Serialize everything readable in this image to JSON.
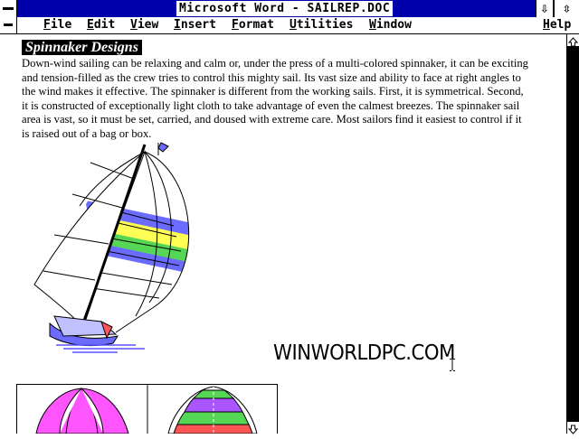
{
  "window": {
    "title": "Microsoft Word - SAILREP.DOC",
    "minimize_glyph": "⇩",
    "maximize_glyph": "⇳"
  },
  "menu": {
    "items": [
      {
        "label": "File"
      },
      {
        "label": "Edit"
      },
      {
        "label": "View"
      },
      {
        "label": "Insert"
      },
      {
        "label": "Format"
      },
      {
        "label": "Utilities"
      },
      {
        "label": "Window"
      }
    ],
    "help": "Help"
  },
  "document": {
    "heading": "Spinnaker Designs",
    "paragraph": "Down-wind sailing can be relaxing and calm or, under the press of a multi-colored spinnaker, it can be exciting and tension-filled as the crew tries to control this mighty sail.  Its vast size and ability to face at right angles to the wind makes it effective. The spinnaker is different from the working sails.  First, it is symmetrical.  Second, it is constructed of exceptionally light cloth to take advantage of even the calmest breezes.  The spinnaker sail area is vast, so it must be set, carried, and doused with extreme care.  Most sailors find it easiest to control if it is raised out of a bag or box.",
    "watermark": "WINWORLDPC.COM"
  },
  "colors": {
    "titlebar": "#0000aa",
    "sail_blue": "#6b6bff",
    "sail_yellow": "#ffff55",
    "sail_green": "#55d655",
    "sail_magenta": "#ff55ff",
    "sail_purple": "#aa55ff",
    "sail_red": "#ff5555",
    "water_blue": "#5555ff"
  }
}
